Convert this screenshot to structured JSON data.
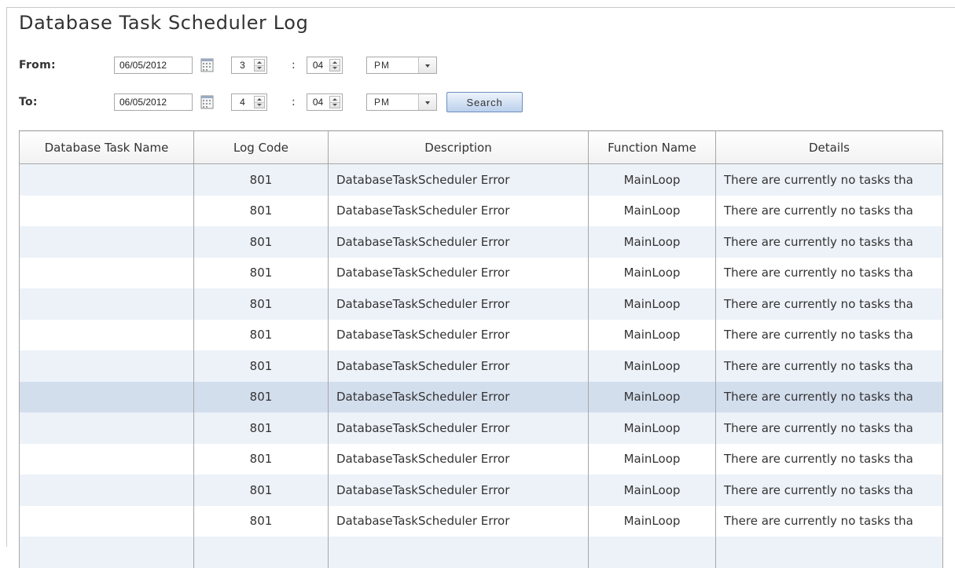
{
  "title": "Database Task Scheduler Log",
  "from": {
    "label": "From:",
    "date": "06/05/2012",
    "hour": "3",
    "minute": "04",
    "ampm": "PM"
  },
  "to": {
    "label": "To:",
    "date": "06/05/2012",
    "hour": "4",
    "minute": "04",
    "ampm": "PM"
  },
  "time_separator": ":",
  "search_label": "Search",
  "icons": {
    "calendar": "calendar-icon",
    "spin_up": "spin-up-arrow-icon",
    "spin_down": "spin-down-arrow-icon",
    "dropdown": "chevron-down-icon"
  },
  "colors": {
    "row_alt": "#edf2f9",
    "row_selected": "#d3deed",
    "button": "#d4e2f4"
  },
  "table": {
    "columns": [
      "Database Task Name",
      "Log Code",
      "Description",
      "Function Name",
      "Details"
    ],
    "selected_row": 7,
    "rows": [
      [
        "",
        "801",
        "DatabaseTaskScheduler Error",
        "MainLoop",
        "There are currently no tasks tha"
      ],
      [
        "",
        "801",
        "DatabaseTaskScheduler Error",
        "MainLoop",
        "There are currently no tasks tha"
      ],
      [
        "",
        "801",
        "DatabaseTaskScheduler Error",
        "MainLoop",
        "There are currently no tasks tha"
      ],
      [
        "",
        "801",
        "DatabaseTaskScheduler Error",
        "MainLoop",
        "There are currently no tasks tha"
      ],
      [
        "",
        "801",
        "DatabaseTaskScheduler Error",
        "MainLoop",
        "There are currently no tasks tha"
      ],
      [
        "",
        "801",
        "DatabaseTaskScheduler Error",
        "MainLoop",
        "There are currently no tasks tha"
      ],
      [
        "",
        "801",
        "DatabaseTaskScheduler Error",
        "MainLoop",
        "There are currently no tasks tha"
      ],
      [
        "",
        "801",
        "DatabaseTaskScheduler Error",
        "MainLoop",
        "There are currently no tasks tha"
      ],
      [
        "",
        "801",
        "DatabaseTaskScheduler Error",
        "MainLoop",
        "There are currently no tasks tha"
      ],
      [
        "",
        "801",
        "DatabaseTaskScheduler Error",
        "MainLoop",
        "There are currently no tasks tha"
      ],
      [
        "",
        "801",
        "DatabaseTaskScheduler Error",
        "MainLoop",
        "There are currently no tasks tha"
      ],
      [
        "",
        "801",
        "DatabaseTaskScheduler Error",
        "MainLoop",
        "There are currently no tasks tha"
      ],
      [
        "",
        "",
        "",
        "",
        ""
      ]
    ]
  }
}
